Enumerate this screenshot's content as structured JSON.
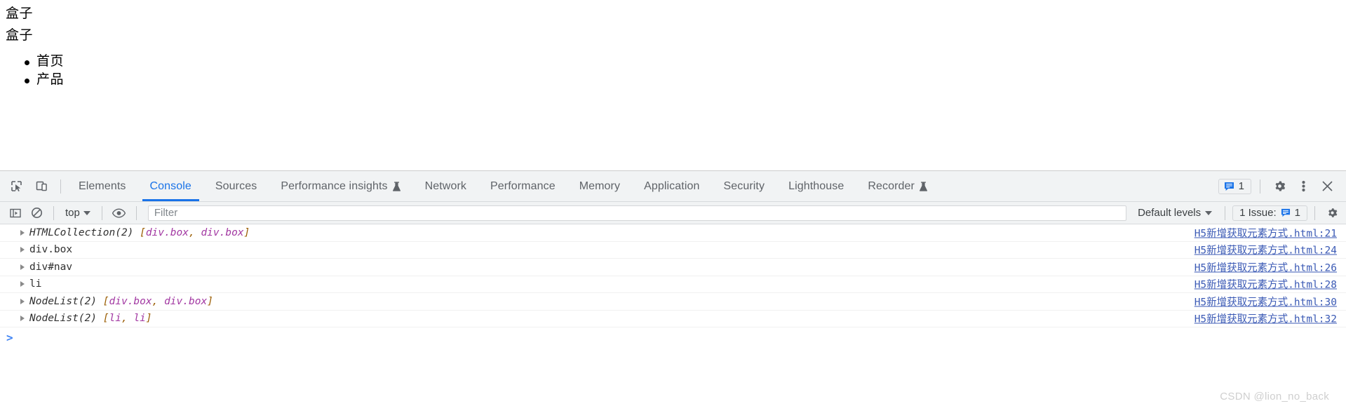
{
  "page": {
    "box_text_1": "盒子",
    "box_text_2": "盒子",
    "nav_items": [
      {
        "label": "首页"
      },
      {
        "label": "产品"
      }
    ]
  },
  "devtools": {
    "left_icons": [
      {
        "name": "inspect-element-icon",
        "title": "Inspect"
      },
      {
        "name": "device-toolbar-icon",
        "title": "Toggle device toolbar"
      }
    ],
    "tabs": [
      {
        "label": "Elements",
        "active": false,
        "icon": ""
      },
      {
        "label": "Console",
        "active": true,
        "icon": ""
      },
      {
        "label": "Sources",
        "active": false,
        "icon": ""
      },
      {
        "label": "Performance insights",
        "active": false,
        "icon": "flask-icon"
      },
      {
        "label": "Network",
        "active": false,
        "icon": ""
      },
      {
        "label": "Performance",
        "active": false,
        "icon": ""
      },
      {
        "label": "Memory",
        "active": false,
        "icon": ""
      },
      {
        "label": "Application",
        "active": false,
        "icon": ""
      },
      {
        "label": "Security",
        "active": false,
        "icon": ""
      },
      {
        "label": "Lighthouse",
        "active": false,
        "icon": ""
      },
      {
        "label": "Recorder",
        "active": false,
        "icon": "flask-icon"
      }
    ],
    "message_badge_count": "1",
    "toolbar_right_icons": [
      {
        "name": "settings-gear-icon"
      },
      {
        "name": "more-options-icon"
      },
      {
        "name": "close-devtools-icon"
      }
    ],
    "filterbar": {
      "sidebar_toggle_icon": "console-sidebar-icon",
      "clear_console_icon": "clear-console-icon",
      "context_label": "top",
      "live_expression_icon": "eye-icon",
      "filter_placeholder": "Filter",
      "filter_value": "",
      "levels_label": "Default levels",
      "issues_label": "1 Issue:",
      "issues_count": "1",
      "settings_icon": "console-settings-gear-icon"
    },
    "console_rows": [
      {
        "prefix": "HTMLCollection(2) ",
        "italic": true,
        "open_bracket": "[",
        "nodes": [
          "div.box",
          "div.box"
        ],
        "close_bracket": "]",
        "source": "H5新增获取元素方式.html:21"
      },
      {
        "prefix": "div.box",
        "italic": false,
        "open_bracket": "",
        "nodes": [],
        "close_bracket": "",
        "source": "H5新增获取元素方式.html:24"
      },
      {
        "prefix": "div#nav",
        "italic": false,
        "open_bracket": "",
        "nodes": [],
        "close_bracket": "",
        "source": "H5新增获取元素方式.html:26"
      },
      {
        "prefix": "li",
        "italic": false,
        "open_bracket": "",
        "nodes": [],
        "close_bracket": "",
        "source": "H5新增获取元素方式.html:28"
      },
      {
        "prefix": "NodeList(2) ",
        "italic": true,
        "open_bracket": "[",
        "nodes": [
          "div.box",
          "div.box"
        ],
        "close_bracket": "]",
        "source": "H5新增获取元素方式.html:30"
      },
      {
        "prefix": "NodeList(2) ",
        "italic": true,
        "open_bracket": "[",
        "nodes": [
          "li",
          "li"
        ],
        "close_bracket": "]",
        "source": "H5新增获取元素方式.html:32"
      }
    ],
    "prompt_chevron": ">",
    "prompt_value": ""
  },
  "watermark": "CSDN @lion_no_back",
  "colors": {
    "accent_blue": "#1a73e8",
    "link_blue": "#3b5ab5",
    "node_purple": "#a238a2",
    "punct_orange": "#9a5c00",
    "toolbar_bg": "#f1f3f4"
  }
}
